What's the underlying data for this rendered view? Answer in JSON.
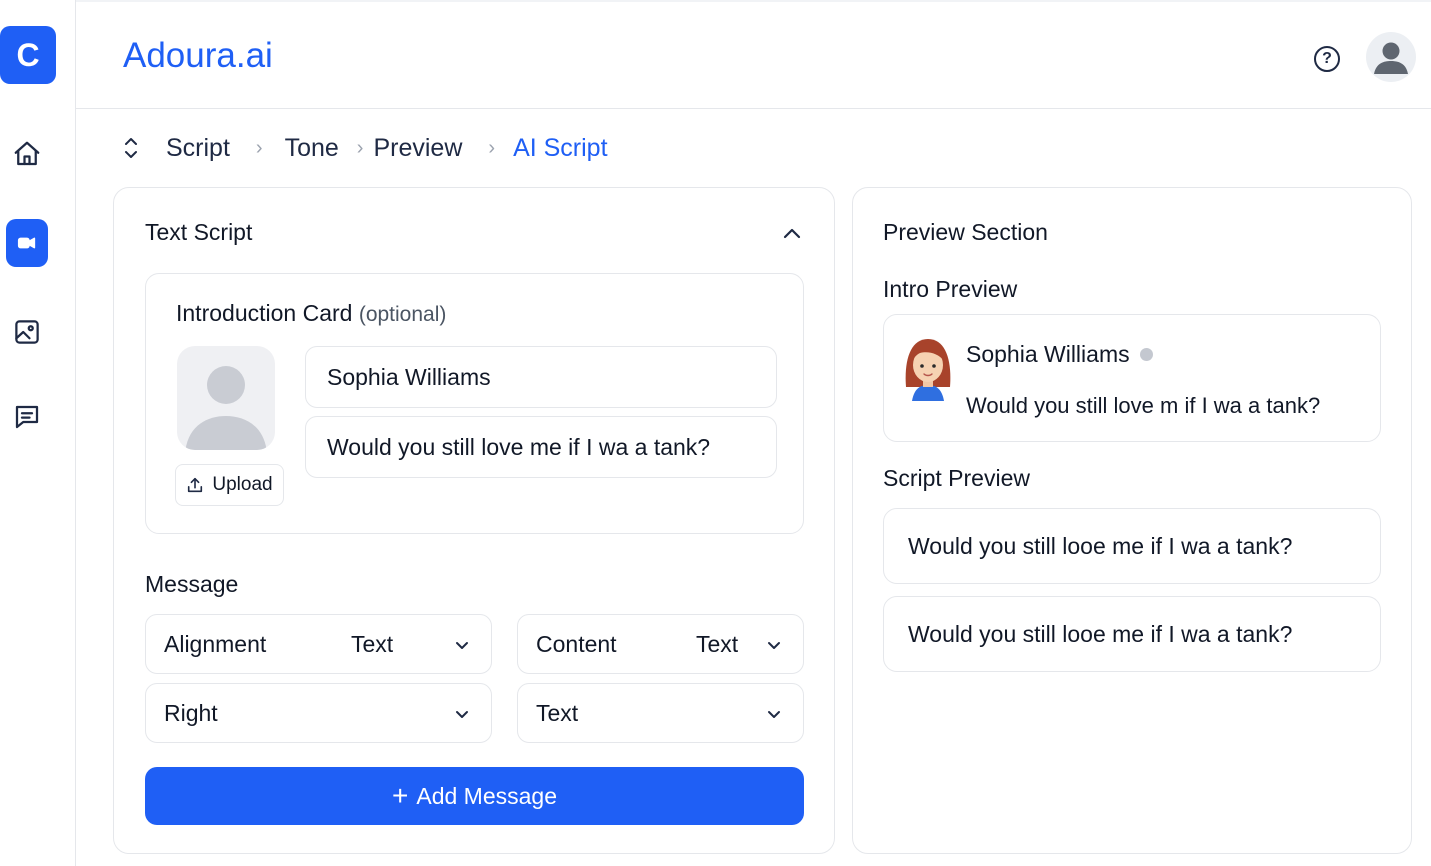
{
  "app": {
    "logo_letter": "C",
    "brand": "Adoura.ai"
  },
  "sidebar": {
    "items": [
      {
        "name": "home",
        "icon": "home-icon",
        "active": false
      },
      {
        "name": "video",
        "icon": "video-icon",
        "active": true
      },
      {
        "name": "image",
        "icon": "image-icon",
        "active": false
      },
      {
        "name": "chat",
        "icon": "chat-icon",
        "active": false
      }
    ]
  },
  "header": {
    "help_icon": "help-circle-icon",
    "help_glyph": "?",
    "avatar_icon": "user-avatar-icon"
  },
  "breadcrumb": {
    "items": [
      "Script",
      "Tone",
      "Preview",
      "AI Script"
    ],
    "active_index": 3
  },
  "text_script": {
    "title": "Text Script",
    "intro_card": {
      "title": "Introduction Card",
      "optional": "(optional)",
      "upload_label": "Upload",
      "name_value": "Sophia Williams",
      "message_value": "Would you still love me if I wa a tank?"
    },
    "message": {
      "label": "Message",
      "alignment_label": "Alignment",
      "alignment_type": "Text",
      "content_label": "Content",
      "content_type": "Text",
      "alignment_value": "Right",
      "content_value": "Text"
    },
    "add_message_label": "Add Message",
    "add_message_plus": "+"
  },
  "preview": {
    "title": "Preview Section",
    "intro_title": "Intro Preview",
    "intro_name": "Sophia Williams",
    "intro_message": "Would you still love m if I wa a tank?",
    "script_title": "Script Preview",
    "script_items": [
      "Would you still looe me if I wa a tank?",
      "Would you still looe me if I wa a tank?"
    ]
  },
  "colors": {
    "accent": "#1f5ff5",
    "border": "#e5e7eb",
    "text": "#111827"
  }
}
